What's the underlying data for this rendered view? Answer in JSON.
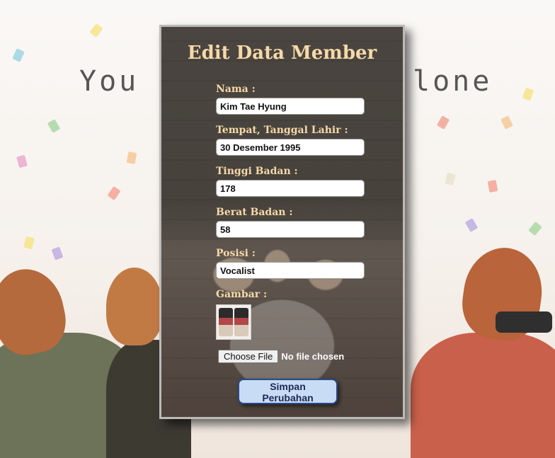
{
  "background": {
    "text_left": "You",
    "text_right": "lone"
  },
  "form": {
    "title": "Edit Data Member",
    "fields": [
      {
        "label": "Nama :",
        "value": "Kim Tae Hyung"
      },
      {
        "label": "Tempat, Tanggal Lahir :",
        "value": "30 Desember 1995"
      },
      {
        "label": "Tinggi Badan :",
        "value": "178"
      },
      {
        "label": "Berat Badan :",
        "value": "58"
      },
      {
        "label": "Posisi :",
        "value": "Vocalist"
      }
    ],
    "image_label": "Gambar :",
    "file_button": "Choose File",
    "file_status": "No file chosen",
    "submit_label": "Simpan Perubahan"
  },
  "colors": {
    "label": "#f5d9a8",
    "button_bg": "#c9dcf5",
    "button_border": "#274a8a"
  }
}
